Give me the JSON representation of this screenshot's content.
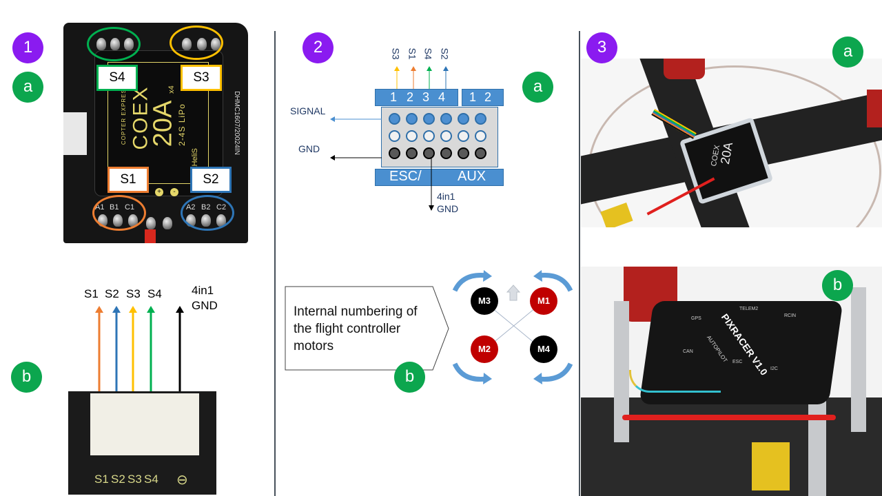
{
  "colors": {
    "purple_badge": "#8a1bf0",
    "green_badge": "#0ca64e",
    "s1": "#ed7d31",
    "s2": "#2e75b6",
    "s3": "#ffc000",
    "s4": "#00b050",
    "gnd": "#000000",
    "connector_blue": "#4a8fd0",
    "motor_red": "#c00000",
    "motor_black": "#000000"
  },
  "panel1": {
    "step_badge": "1",
    "badge_a": "a",
    "badge_b": "b",
    "esc_photo": {
      "brand": "COEX",
      "brand_sub": "COPTER EXPRESS",
      "rating": "20A",
      "rating_suffix": "x4",
      "battery": "2-4S LiPo",
      "firmware": "BLHeliS",
      "pads_left": [
        "A1",
        "B1",
        "C1"
      ],
      "pads_right": [
        "A2",
        "B2",
        "C2"
      ],
      "power_pads": [
        "+",
        "-"
      ],
      "side_code": "DHMC1607/20024IN",
      "conn_silk": "S1S2S3S4"
    },
    "motor_labels": [
      {
        "label": "S4",
        "position": "top-left",
        "color": "#00b050"
      },
      {
        "label": "S3",
        "position": "top-right",
        "color": "#ffc000"
      },
      {
        "label": "S1",
        "position": "bottom-left",
        "color": "#ed7d31"
      },
      {
        "label": "S2",
        "position": "bottom-right",
        "color": "#2e75b6"
      }
    ],
    "connector": {
      "signals": [
        {
          "label": "S1",
          "color": "#ed7d31"
        },
        {
          "label": "S2",
          "color": "#2e75b6"
        },
        {
          "label": "S3",
          "color": "#ffc000"
        },
        {
          "label": "S4",
          "color": "#00b050"
        }
      ],
      "gnd_label_1": "4in1",
      "gnd_label_2": "GND",
      "silk_labels": [
        "S1",
        "S2",
        "S3",
        "S4",
        "⊖"
      ]
    }
  },
  "panel2": {
    "step_badge": "2",
    "badge_a": "a",
    "badge_b": "b",
    "pinout": {
      "top_signals": [
        {
          "label": "S3",
          "color": "#ffc000"
        },
        {
          "label": "S1",
          "color": "#ed7d31"
        },
        {
          "label": "S4",
          "color": "#00b050"
        },
        {
          "label": "S2",
          "color": "#2e75b6"
        }
      ],
      "esc_pins": [
        "1",
        "2",
        "3",
        "4"
      ],
      "aux_pins": [
        "1",
        "2"
      ],
      "signal_label": "SIGNAL",
      "gnd_label": "GND",
      "bottom_left": "ESC/",
      "bottom_right": "AUX",
      "bottom_gnd_1": "4in1",
      "bottom_gnd_2": "GND"
    },
    "callout_text": "Internal numbering of the flight controller motors",
    "motors": [
      {
        "label": "M3",
        "position": "top-left",
        "color": "#000000"
      },
      {
        "label": "M1",
        "position": "top-right",
        "color": "#c00000"
      },
      {
        "label": "M2",
        "position": "bottom-left",
        "color": "#c00000"
      },
      {
        "label": "M4",
        "position": "bottom-right",
        "color": "#000000"
      }
    ]
  },
  "panel3": {
    "step_badge": "3",
    "badge_a": "a",
    "badge_b": "b",
    "photo_a_chip": {
      "brand": "COEX",
      "rating": "20A"
    },
    "photo_b_fc": {
      "name": "PIXRACER V1.0",
      "sub": "AUTOPILOT",
      "ports": [
        "TELEM2",
        "RCIN",
        "CAN",
        "ESC",
        "I2C",
        "GPS"
      ]
    }
  }
}
